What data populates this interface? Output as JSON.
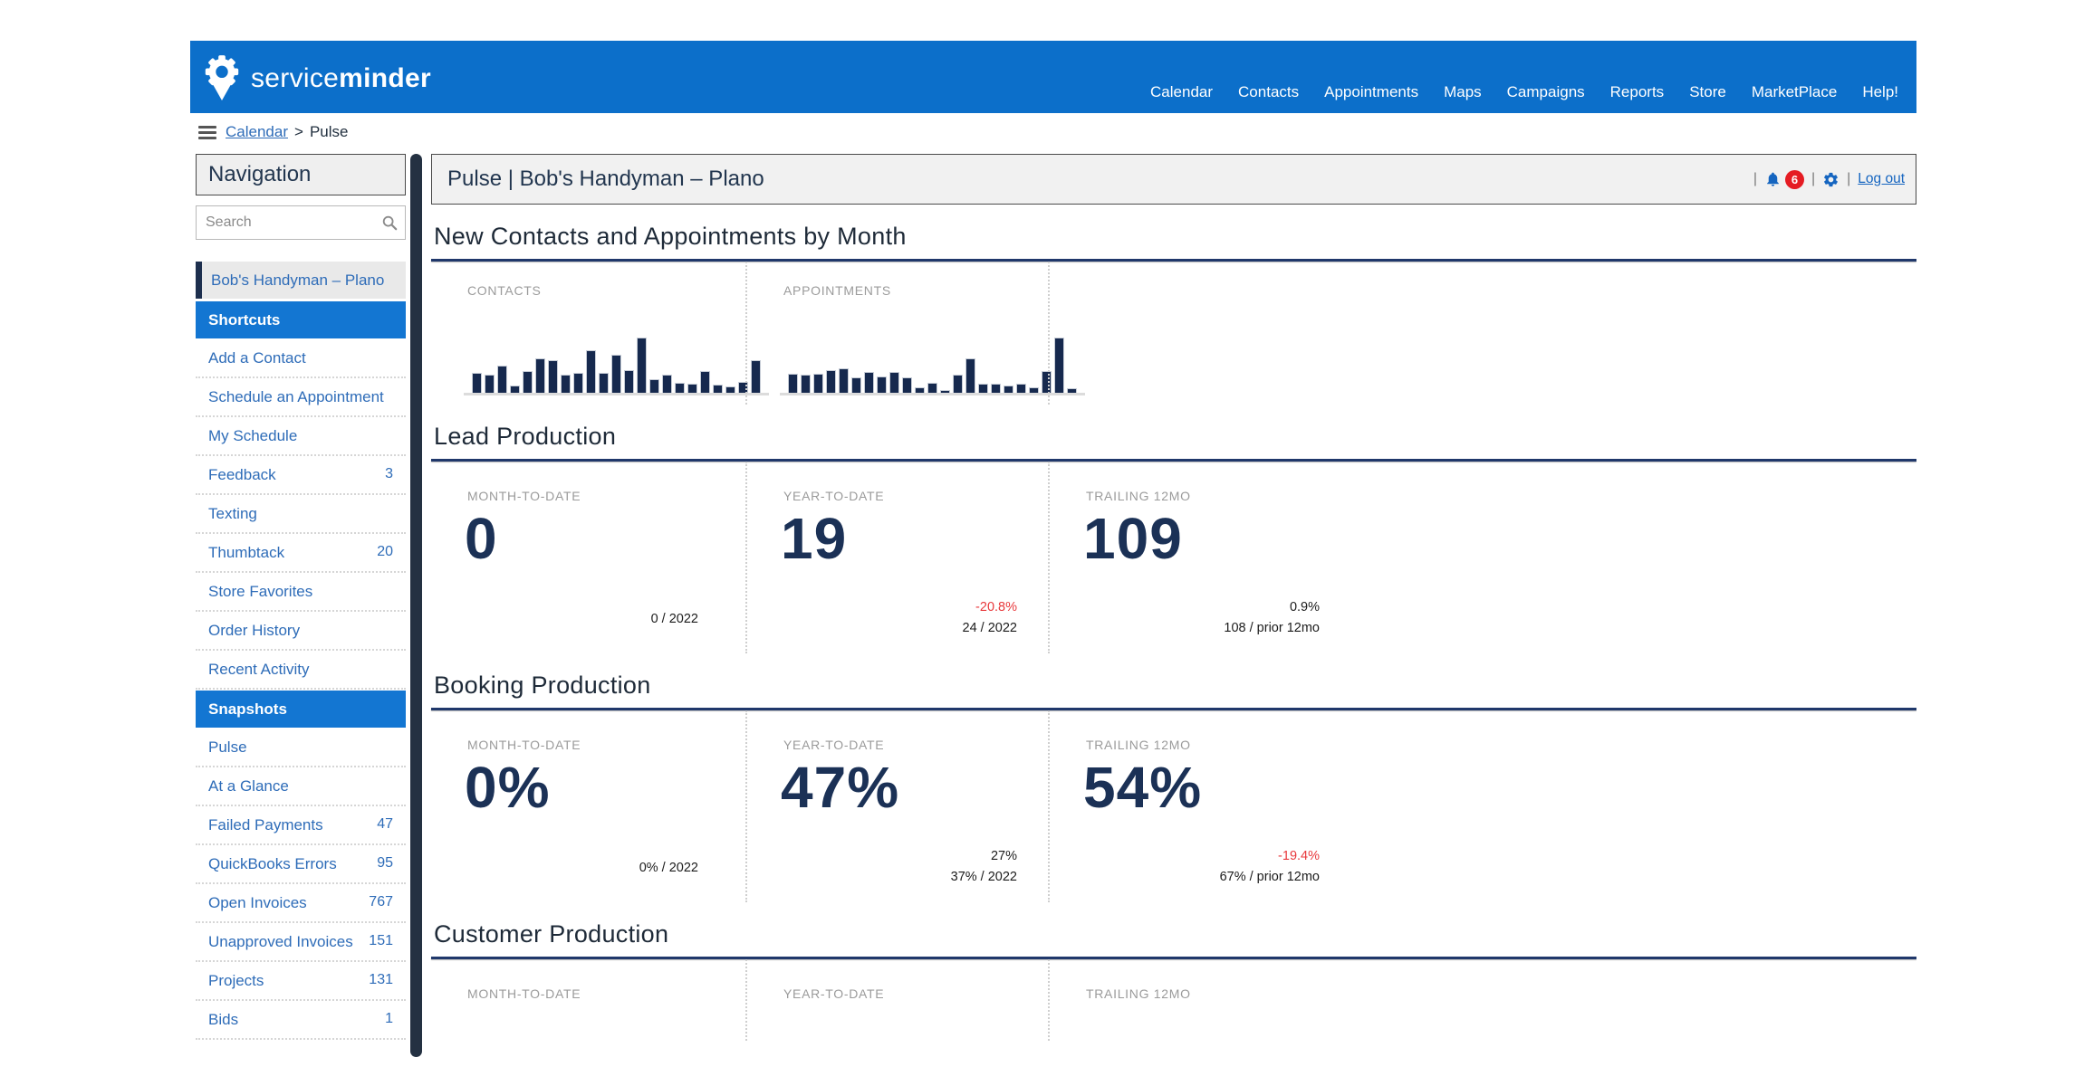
{
  "header": {
    "logo": {
      "text_light": "service",
      "text_bold": "minder"
    },
    "nav": [
      "Calendar",
      "Contacts",
      "Appointments",
      "Maps",
      "Campaigns",
      "Reports",
      "Store",
      "MarketPlace",
      "Help!"
    ]
  },
  "breadcrumb": {
    "link": "Calendar",
    "separator": ">",
    "current": "Pulse"
  },
  "sidebar": {
    "title": "Navigation",
    "search_placeholder": "Search",
    "items": [
      {
        "label": "Bob's Handyman – Plano"
      },
      {
        "label": "Shortcuts"
      },
      {
        "label": "Add a Contact"
      },
      {
        "label": "Schedule an Appointment"
      },
      {
        "label": "My Schedule"
      },
      {
        "label": "Feedback",
        "count": "3"
      },
      {
        "label": "Texting"
      },
      {
        "label": "Thumbtack",
        "count": "20"
      },
      {
        "label": "Store Favorites"
      },
      {
        "label": "Order History"
      },
      {
        "label": "Recent Activity"
      },
      {
        "label": "Snapshots"
      },
      {
        "label": "Pulse"
      },
      {
        "label": "At a Glance"
      },
      {
        "label": "Failed Payments",
        "count": "47"
      },
      {
        "label": "QuickBooks Errors",
        "count": "95"
      },
      {
        "label": "Open Invoices",
        "count": "767"
      },
      {
        "label": "Unapproved Invoices",
        "count": "151"
      },
      {
        "label": "Projects",
        "count": "131"
      },
      {
        "label": "Bids",
        "count": "1"
      }
    ]
  },
  "main": {
    "title": "Pulse | Bob's Handyman – Plano",
    "toolbar": {
      "notification_count": "6",
      "logout_label": "Log out"
    }
  },
  "sections": {
    "charts": {
      "heading": "New Contacts and Appointments by Month",
      "columns": [
        {
          "label": "CONTACTS"
        },
        {
          "label": "APPOINTMENTS"
        }
      ]
    },
    "lead": {
      "heading": "Lead Production",
      "cols": [
        {
          "label": "MONTH-TO-DATE",
          "value": "0",
          "sub": "0 / 2022"
        },
        {
          "label": "YEAR-TO-DATE",
          "value": "19",
          "delta": "-20.8%",
          "sub": "24 / 2022"
        },
        {
          "label": "TRAILING 12MO",
          "value": "109",
          "delta": "0.9%",
          "sub": "108 / prior 12mo"
        }
      ]
    },
    "booking": {
      "heading": "Booking Production",
      "cols": [
        {
          "label": "MONTH-TO-DATE",
          "value": "0%",
          "sub": "0% / 2022"
        },
        {
          "label": "YEAR-TO-DATE",
          "value": "47%",
          "delta": "27%",
          "sub": "37% / 2022"
        },
        {
          "label": "TRAILING 12MO",
          "value": "54%",
          "delta": "-19.4%",
          "sub": "67% / prior 12mo"
        }
      ]
    },
    "customer": {
      "heading": "Customer Production",
      "cols": [
        {
          "label": "MONTH-TO-DATE"
        },
        {
          "label": "YEAR-TO-DATE"
        },
        {
          "label": "TRAILING 12MO"
        }
      ]
    }
  },
  "chart_data": [
    {
      "type": "bar",
      "title": "CONTACTS",
      "units": "relative_height_pct",
      "values": [
        35,
        31,
        48,
        12,
        38,
        62,
        58,
        31,
        35,
        77,
        35,
        69,
        40,
        100,
        23,
        31,
        17,
        15,
        38,
        13,
        10,
        19,
        58
      ]
    },
    {
      "type": "bar",
      "title": "APPOINTMENTS",
      "units": "relative_height_pct",
      "values": [
        34,
        32,
        34,
        40,
        43,
        26,
        36,
        28,
        36,
        26,
        9,
        17,
        4,
        32,
        62,
        15,
        15,
        11,
        15,
        9,
        38,
        100,
        7
      ]
    }
  ],
  "colors": {
    "header_blue": "#0c6fca",
    "selected_blue": "#1376d2",
    "navy": "#1b3156",
    "link_blue": "#2e6cb8",
    "negative_red": "#e8393c",
    "badge_red": "#e51c23"
  }
}
